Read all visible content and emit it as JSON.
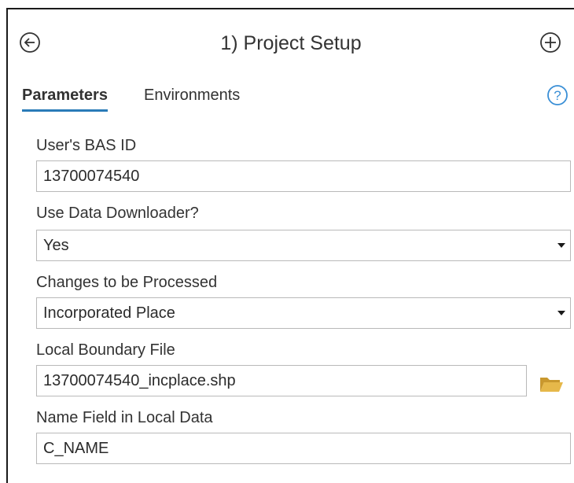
{
  "header": {
    "title": "1) Project Setup",
    "back_icon": "back-arrow-circle-icon",
    "add_icon": "plus-circle-icon"
  },
  "tabs": [
    {
      "label": "Parameters",
      "active": true
    },
    {
      "label": "Environments",
      "active": false
    }
  ],
  "help_icon": "help-question-icon",
  "fields": {
    "bas_id": {
      "label": "User's BAS ID",
      "value": "13700074540"
    },
    "use_downloader": {
      "label": "Use Data Downloader?",
      "value": "Yes"
    },
    "changes": {
      "label": "Changes to be Processed",
      "value": "Incorporated Place"
    },
    "boundary_file": {
      "label": "Local Boundary File",
      "value": "13700074540_incplace.shp"
    },
    "name_field": {
      "label": "Name Field in Local Data",
      "value": "C_NAME"
    }
  },
  "colors": {
    "accent": "#2a7bb8",
    "help": "#3a8fd6",
    "folder": "#e6b84a",
    "border": "#b9b9b9"
  }
}
